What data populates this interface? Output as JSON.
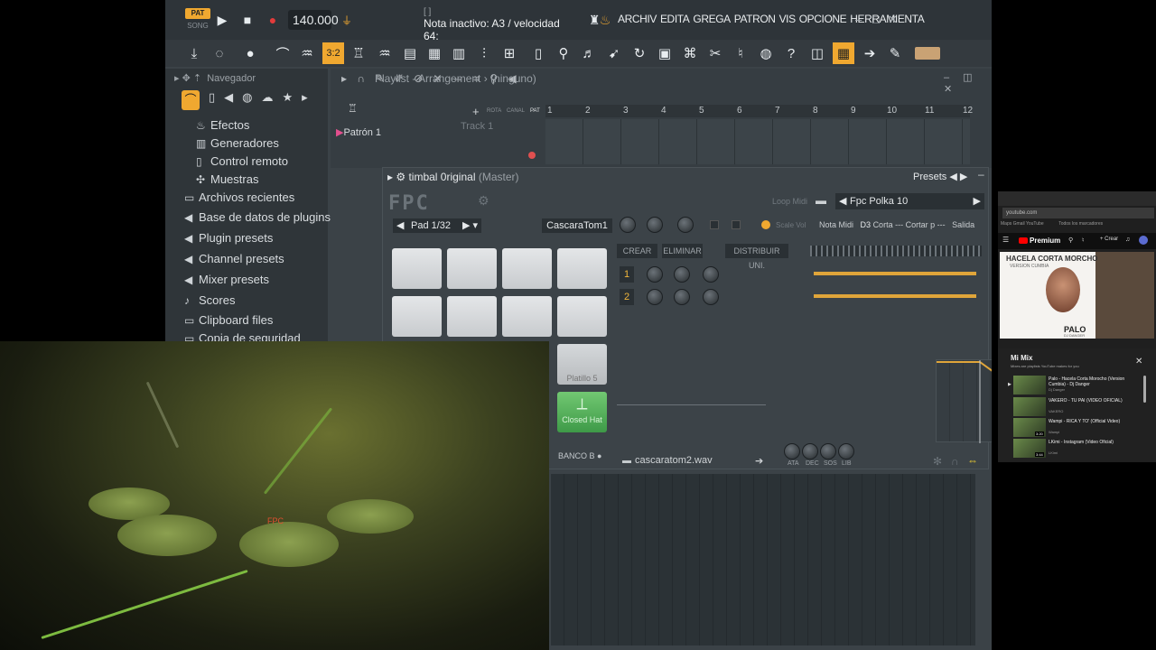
{
  "topbar": {
    "pat_label": "PAT",
    "song_label": "SONG",
    "tempo": "140.000",
    "hint_line1": "[ ]",
    "hint_line2": "Nota inactivo: A3 / velocidad 64:",
    "menu": [
      "ARCHIV",
      "EDITA",
      "GREGA",
      "PATRON",
      "VIS",
      "OPCIONE",
      "HERRAMIENTA"
    ],
    "window_controls": [
      "–",
      "□",
      "✕"
    ]
  },
  "browser": {
    "title": "Navegador",
    "items": [
      {
        "icon": "effects-icon",
        "label": "Efectos"
      },
      {
        "icon": "generators-icon",
        "label": "Generadores"
      },
      {
        "icon": "remote-control-icon",
        "label": "Control remoto"
      },
      {
        "icon": "samples-icon",
        "label": "Muestras"
      },
      {
        "icon": "folder-icon",
        "label": "Archivos recientes"
      },
      {
        "icon": "plugin-db-icon",
        "label": "Base de datos de plugins"
      },
      {
        "icon": "plugin-presets-icon",
        "label": "Plugin presets"
      },
      {
        "icon": "channel-presets-icon",
        "label": "Channel presets"
      },
      {
        "icon": "mixer-presets-icon",
        "label": "Mixer presets"
      },
      {
        "icon": "note-icon",
        "label": "Scores"
      },
      {
        "icon": "clipboard-icon",
        "label": "Clipboard files"
      },
      {
        "icon": "folder-icon",
        "label": "Copia de seguridad"
      }
    ]
  },
  "playlist": {
    "title": "Playlist - Arrangement",
    "subtitle": "(ninguno)",
    "pattern": "Patrón 1",
    "track": "Track 1",
    "col_labels": [
      "ROTA",
      "CANAL",
      "PAT"
    ],
    "bars": [
      "1",
      "2",
      "3",
      "4",
      "5",
      "6",
      "7",
      "8",
      "9",
      "10",
      "11",
      "12"
    ]
  },
  "fpc": {
    "title": "timbal 0riginal",
    "title_master": "(Master)",
    "presets_label": "Presets",
    "logo": "FPC",
    "loop_midi": "Loop Midi",
    "preset_name": "Fpc Polka 10",
    "pad_selector": "Pad 1/32",
    "pad_name": "CascaraTom1",
    "scale_vol": "Scale Vol",
    "nota_midi_label": "Nota Midi",
    "nota_midi_value": "D3",
    "corta_label": "Corta",
    "cortar_p": "--- Cortar p ---",
    "salida": "Salida",
    "btn_crear": "CREAR",
    "btn_eliminar": "ELIMINAR",
    "btn_distribuir": "DISTRIBUIR UNI.",
    "layers": [
      "1",
      "2"
    ],
    "pad_platillo": "Platillo 5",
    "pad_closed_hat": "Closed Hat",
    "banco": "BANCO B",
    "wav_file": "cascaratom2.wav",
    "env_labels": [
      "ATA",
      "DEC",
      "SOS",
      "LIB"
    ]
  },
  "webcam": {
    "drum_brand_label": "FPC"
  },
  "youtube": {
    "url": "youtube.com",
    "bookmarks": "Maps   Gmail   YouTube",
    "all_bookmarks": "Todos los marcadores",
    "premium": "Premium",
    "crear": "+ Crear",
    "thumb_title": "HACELA CORTA MORCHO",
    "thumb_sub": "VERSION CUMBIA",
    "artist": "PALO",
    "artist_sub": "DJ DANGER",
    "mix_title": "Mi Mix",
    "mix_sub": "Mixes are playlists YouTube makes for you",
    "items": [
      {
        "title": "Palo - Hacela Corta Morocho (Version Cumbia) - Dj Danger",
        "channel": "Dj Danger",
        "duration": ""
      },
      {
        "title": "VAKERO - TU PAI (VIDEO OFICIAL)",
        "channel": "VAKERO",
        "duration": ""
      },
      {
        "title": "Wampi - RICA Y TO' (Official Video)",
        "channel": "Wampi",
        "duration": "3:20"
      },
      {
        "title": "LKimi - Instagram (Video Oficial)",
        "channel": "LKimi",
        "duration": "3:44"
      }
    ]
  }
}
